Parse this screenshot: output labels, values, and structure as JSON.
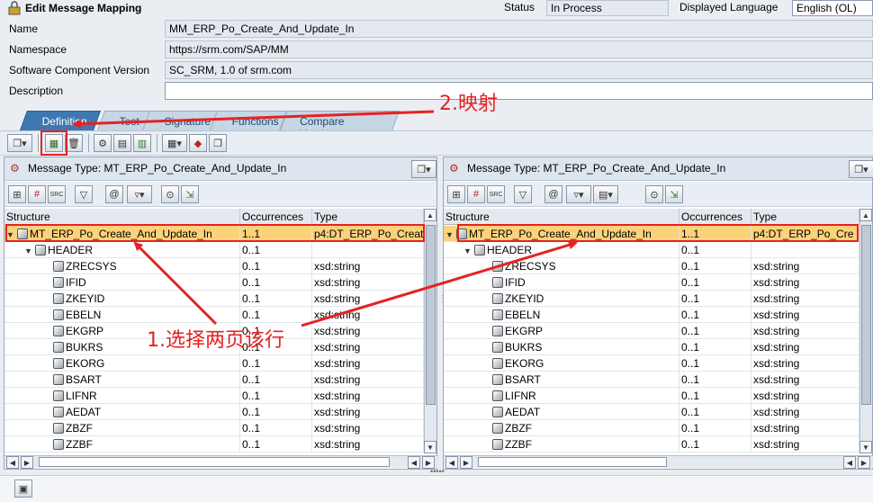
{
  "header": {
    "title": "Edit Message Mapping",
    "status_label": "Status",
    "status_value": "In Process",
    "language_label": "Displayed Language",
    "language_value": "English (OL)",
    "name_label": "Name",
    "name_value": "MM_ERP_Po_Create_And_Update_In",
    "namespace_label": "Namespace",
    "namespace_value": "https://srm.com/SAP/MM",
    "swcv_label": "Software Component Version",
    "swcv_value": "SC_SRM, 1.0 of srm.com",
    "description_label": "Description",
    "description_value": ""
  },
  "tabs": [
    {
      "label": "Definition",
      "active": true
    },
    {
      "label": "Test"
    },
    {
      "label": "Signature"
    },
    {
      "label": "Functions"
    },
    {
      "label": "Compare Versions"
    }
  ],
  "left_panel": {
    "title": "Message Type: MT_ERP_Po_Create_And_Update_In",
    "columns": [
      "Structure",
      "Occurrences",
      "Type"
    ],
    "rows": [
      {
        "name": "MT_ERP_Po_Create_And_Update_In",
        "occ": "1..1",
        "type": "p4:DT_ERP_Po_Creat",
        "level": 0,
        "selected": true
      },
      {
        "name": "HEADER",
        "occ": "0..1",
        "type": "",
        "level": 1
      },
      {
        "name": "ZRECSYS",
        "occ": "0..1",
        "type": "xsd:string",
        "level": 2
      },
      {
        "name": "IFID",
        "occ": "0..1",
        "type": "xsd:string",
        "level": 2
      },
      {
        "name": "ZKEYID",
        "occ": "0..1",
        "type": "xsd:string",
        "level": 2
      },
      {
        "name": "EBELN",
        "occ": "0..1",
        "type": "xsd:string",
        "level": 2
      },
      {
        "name": "EKGRP",
        "occ": "0..1",
        "type": "xsd:string",
        "level": 2
      },
      {
        "name": "BUKRS",
        "occ": "0..1",
        "type": "xsd:string",
        "level": 2
      },
      {
        "name": "EKORG",
        "occ": "0..1",
        "type": "xsd:string",
        "level": 2
      },
      {
        "name": "BSART",
        "occ": "0..1",
        "type": "xsd:string",
        "level": 2
      },
      {
        "name": "LIFNR",
        "occ": "0..1",
        "type": "xsd:string",
        "level": 2
      },
      {
        "name": "AEDAT",
        "occ": "0..1",
        "type": "xsd:string",
        "level": 2
      },
      {
        "name": "ZBZF",
        "occ": "0..1",
        "type": "xsd:string",
        "level": 2
      },
      {
        "name": "ZZBF",
        "occ": "0..1",
        "type": "xsd:string",
        "level": 2
      }
    ]
  },
  "right_panel": {
    "title": "Message Type: MT_ERP_Po_Create_And_Update_In",
    "columns": [
      "Structure",
      "Occurrences",
      "Type"
    ],
    "rows": [
      {
        "name": "MT_ERP_Po_Create_And_Update_In",
        "occ": "1..1",
        "type": "p4:DT_ERP_Po_Cre",
        "level": 0,
        "selected": true
      },
      {
        "name": "HEADER",
        "occ": "0..1",
        "type": "",
        "level": 1
      },
      {
        "name": "ZRECSYS",
        "occ": "0..1",
        "type": "xsd:string",
        "level": 2
      },
      {
        "name": "IFID",
        "occ": "0..1",
        "type": "xsd:string",
        "level": 2
      },
      {
        "name": "ZKEYID",
        "occ": "0..1",
        "type": "xsd:string",
        "level": 2
      },
      {
        "name": "EBELN",
        "occ": "0..1",
        "type": "xsd:string",
        "level": 2
      },
      {
        "name": "EKGRP",
        "occ": "0..1",
        "type": "xsd:string",
        "level": 2
      },
      {
        "name": "BUKRS",
        "occ": "0..1",
        "type": "xsd:string",
        "level": 2
      },
      {
        "name": "EKORG",
        "occ": "0..1",
        "type": "xsd:string",
        "level": 2
      },
      {
        "name": "BSART",
        "occ": "0..1",
        "type": "xsd:string",
        "level": 2
      },
      {
        "name": "LIFNR",
        "occ": "0..1",
        "type": "xsd:string",
        "level": 2
      },
      {
        "name": "AEDAT",
        "occ": "0..1",
        "type": "xsd:string",
        "level": 2
      },
      {
        "name": "ZBZF",
        "occ": "0..1",
        "type": "xsd:string",
        "level": 2
      },
      {
        "name": "ZZBF",
        "occ": "0..1",
        "type": "xsd:string",
        "level": 2
      }
    ]
  },
  "annotations": {
    "map_note": "2.映射",
    "select_note": "1.选择两页该行"
  },
  "colors": {
    "annotation": "#e52222",
    "selected_row": "#fcd27a",
    "active_tab": "#3f78b0"
  }
}
